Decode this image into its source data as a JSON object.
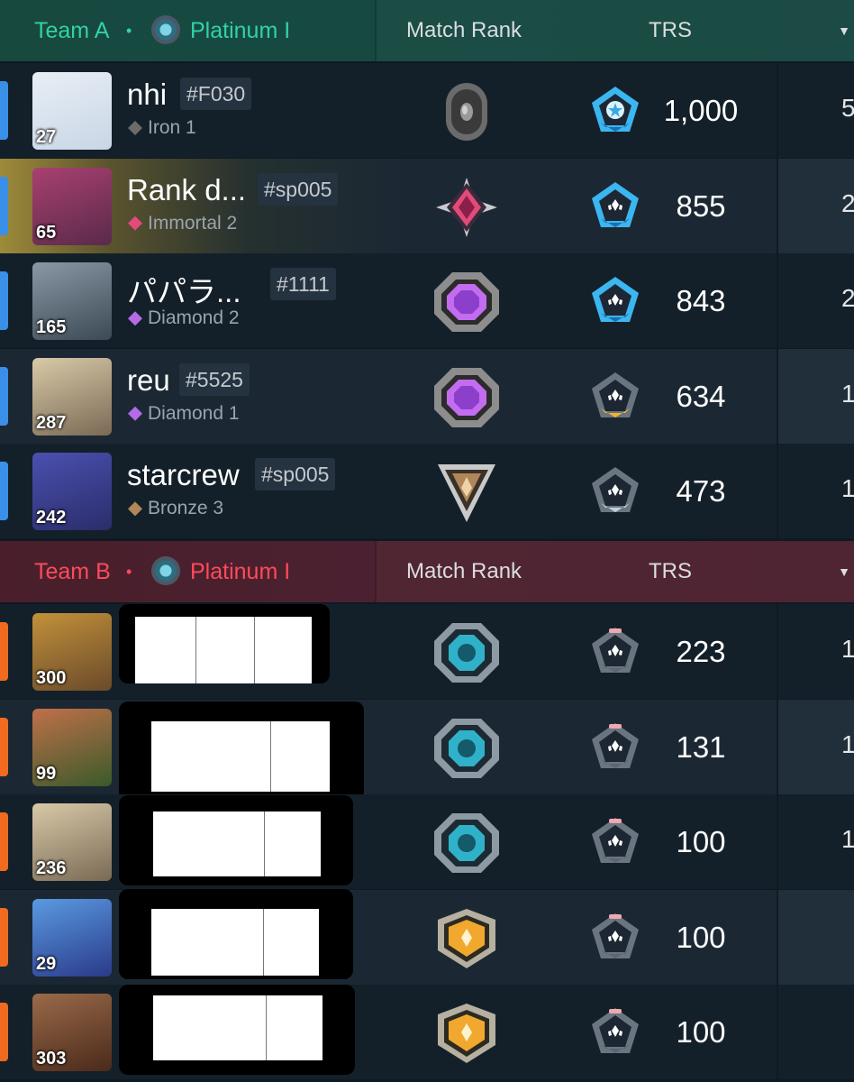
{
  "team_a": {
    "name": "Team A",
    "separator": "•",
    "rank": "Platinum I",
    "col_match_rank": "Match Rank",
    "col_trs": "TRS",
    "accent_color": "#33d1a3",
    "players": [
      {
        "level": "27",
        "name": "nhi",
        "tag": "#F030",
        "rank": "Iron 1",
        "match_rank_icon": "iron-rank-icon",
        "trs_icon": "trs-blue-star-icon",
        "trs": "1,000",
        "side_value": "5"
      },
      {
        "level": "65",
        "name": "Rank d...",
        "tag": "#sp005",
        "rank": "Immortal 2",
        "match_rank_icon": "immortal-rank-icon",
        "trs_icon": "trs-blue-icon",
        "trs": "855",
        "side_value": "2"
      },
      {
        "level": "165",
        "name": "パパラ...",
        "tag": "#1111",
        "rank": "Diamond 2",
        "match_rank_icon": "diamond-rank-icon",
        "trs_icon": "trs-blue-icon",
        "trs": "843",
        "side_value": "2"
      },
      {
        "level": "287",
        "name": "reu",
        "tag": "#5525",
        "rank": "Diamond 1",
        "match_rank_icon": "diamond-rank-icon",
        "trs_icon": "trs-gold-icon",
        "trs": "634",
        "side_value": "1"
      },
      {
        "level": "242",
        "name": "starcrew",
        "tag": "#sp005",
        "rank": "Bronze 3",
        "match_rank_icon": "bronze-rank-icon",
        "trs_icon": "trs-silver-icon",
        "trs": "473",
        "side_value": "1"
      }
    ]
  },
  "team_b": {
    "name": "Team B",
    "separator": "•",
    "rank": "Platinum I",
    "col_match_rank": "Match Rank",
    "col_trs": "TRS",
    "accent_color": "#ff4a5a",
    "players": [
      {
        "level": "300",
        "match_rank_icon": "platinum-rank-icon",
        "trs_icon": "trs-pink-icon",
        "trs": "223",
        "side_value": "1"
      },
      {
        "level": "99",
        "match_rank_icon": "platinum-rank-icon",
        "trs_icon": "trs-pink-icon",
        "trs": "131",
        "side_value": "1"
      },
      {
        "level": "236",
        "match_rank_icon": "platinum-rank-icon",
        "trs_icon": "trs-pink-icon",
        "trs": "100",
        "side_value": "1"
      },
      {
        "level": "29",
        "match_rank_icon": "gold-rank-icon",
        "trs_icon": "trs-pink-icon",
        "trs": "100",
        "side_value": ""
      },
      {
        "level": "303",
        "match_rank_icon": "gold-rank-icon",
        "trs_icon": "trs-pink-icon",
        "trs": "100",
        "side_value": ""
      }
    ]
  },
  "header_sort_icon": "sort-down-icon"
}
